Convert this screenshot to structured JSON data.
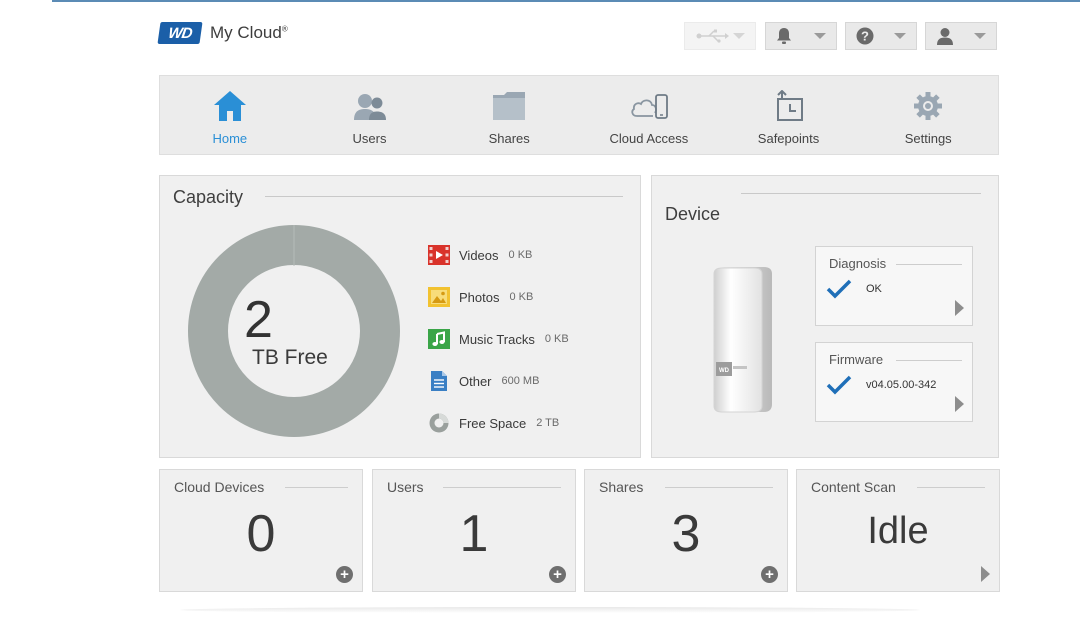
{
  "header": {
    "brand_badge": "WD",
    "brand_name": "My Cloud",
    "brand_mark": "®",
    "buttons": [
      {
        "name": "usb",
        "icon": "usb-icon",
        "enabled": false
      },
      {
        "name": "alerts",
        "icon": "bell-icon",
        "enabled": true
      },
      {
        "name": "help",
        "icon": "question-icon",
        "enabled": true
      },
      {
        "name": "account",
        "icon": "user-icon",
        "enabled": true
      }
    ]
  },
  "nav": {
    "items": [
      {
        "label": "Home",
        "icon": "home-icon",
        "active": true
      },
      {
        "label": "Users",
        "icon": "users-icon",
        "active": false
      },
      {
        "label": "Shares",
        "icon": "folder-icon",
        "active": false
      },
      {
        "label": "Cloud Access",
        "icon": "cloud-phone-icon",
        "active": false
      },
      {
        "label": "Safepoints",
        "icon": "safepoint-icon",
        "active": false
      },
      {
        "label": "Settings",
        "icon": "gear-icon",
        "active": false
      }
    ]
  },
  "capacity": {
    "title": "Capacity",
    "free_number": "2",
    "free_label": "TB Free",
    "legend": [
      {
        "name": "Videos",
        "value": "0 KB",
        "icon": "video-icon",
        "color": "#d9332b"
      },
      {
        "name": "Photos",
        "value": "0 KB",
        "icon": "photo-icon",
        "color": "#f2c230"
      },
      {
        "name": "Music Tracks",
        "value": "0 KB",
        "icon": "music-icon",
        "color": "#3aa548"
      },
      {
        "name": "Other",
        "value": "600 MB",
        "icon": "document-icon",
        "color": "#3a7fc4"
      },
      {
        "name": "Free Space",
        "value": "2 TB",
        "icon": "free-space-icon",
        "color": "#9aa09d"
      }
    ]
  },
  "device": {
    "title": "Device",
    "diagnosis": {
      "title": "Diagnosis",
      "value": "OK"
    },
    "firmware": {
      "title": "Firmware",
      "value": "v04.05.00-342"
    }
  },
  "stats": [
    {
      "title": "Cloud Devices",
      "value": "0",
      "action": "plus"
    },
    {
      "title": "Users",
      "value": "1",
      "action": "plus"
    },
    {
      "title": "Shares",
      "value": "3",
      "action": "plus"
    },
    {
      "title": "Content Scan",
      "value": "Idle",
      "action": "arrow"
    }
  ],
  "colors": {
    "accent": "#2a8fd6",
    "brand": "#1b5fa8",
    "check": "#1f6fb8",
    "donut": "#a3aaa7"
  }
}
